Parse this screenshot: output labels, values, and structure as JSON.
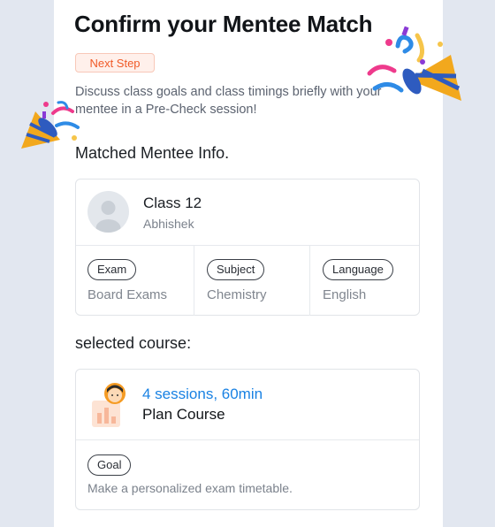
{
  "header": {
    "title": "Confirm your Mentee Match",
    "badge": "Next Step",
    "description": "Discuss class goals and class timings briefly with your mentee in a Pre-Check session!"
  },
  "mentee": {
    "section_label": "Matched Mentee Info.",
    "class": "Class 12",
    "name": "Abhishek",
    "fields": [
      {
        "label": "Exam",
        "value": "Board Exams"
      },
      {
        "label": "Subject",
        "value": "Chemistry"
      },
      {
        "label": "Language",
        "value": "English"
      }
    ]
  },
  "course": {
    "section_label": "selected course:",
    "sessions": "4 sessions, 60min",
    "plan": "Plan Course",
    "goal_label": "Goal",
    "goal_text": "Make a personalized exam timetable."
  },
  "icons": {
    "avatar": "user-avatar-placeholder-icon",
    "course": "mentor-chart-icon",
    "decor": "party-popper-icon"
  },
  "colors": {
    "accent_orange": "#f05a28",
    "accent_blue": "#1a82e3",
    "background": "#e2e7f0"
  }
}
